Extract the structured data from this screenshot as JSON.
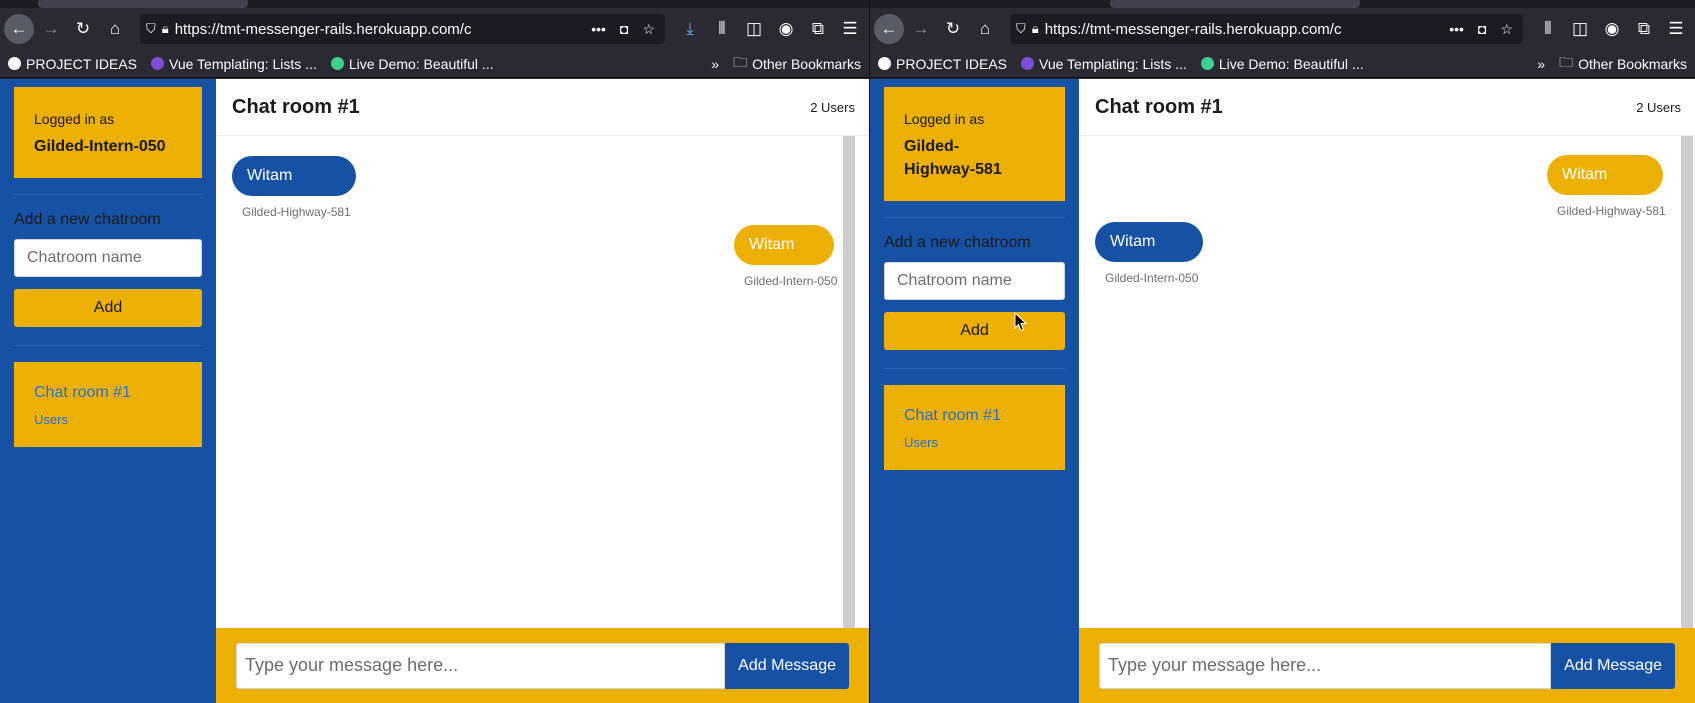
{
  "browser": {
    "url": "https://tmt-messenger-rails.herokuapp.com/c",
    "url_right": "https://tmt-messenger-rails.herokuapp.com/c",
    "bookmarks": [
      {
        "label": "PROJECT IDEAS",
        "icon": "github-icon",
        "color": "#ffffff"
      },
      {
        "label": "Vue Templating: Lists ...",
        "icon": "vue-mastery-icon",
        "color": "#7e4fd6"
      },
      {
        "label": "Live Demo: Beautiful ...",
        "icon": "vue-icon",
        "color": "#3ecf8e"
      }
    ],
    "other_bookmarks": "Other Bookmarks"
  },
  "left": {
    "logged_in_label": "Logged in as",
    "username": "Gilded-Intern-050",
    "add_chatroom_label": "Add a new chatroom",
    "chatroom_placeholder": "Chatroom name",
    "add_button": "Add",
    "rooms": [
      {
        "name": "Chat room #1",
        "users": "Users"
      }
    ],
    "chat_title": "Chat room #1",
    "user_count": "2 Users",
    "messages": [
      {
        "text": "Witam",
        "user": "Gilded-Highway-581",
        "side": "left",
        "color": "blue"
      },
      {
        "text": "Witam",
        "user": "Gilded-Intern-050",
        "side": "right",
        "color": "yellow"
      }
    ],
    "message_placeholder": "Type your message here...",
    "send_button": "Add Message"
  },
  "right": {
    "logged_in_label": "Logged in as",
    "username_line1": "Gilded-",
    "username_line2": "Highway-581",
    "add_chatroom_label": "Add a new chatroom",
    "chatroom_placeholder": "Chatroom name",
    "add_button": "Add",
    "rooms": [
      {
        "name": "Chat room #1",
        "users": "Users"
      }
    ],
    "chat_title": "Chat room #1",
    "user_count": "2 Users",
    "messages": [
      {
        "text": "Witam",
        "user": "Gilded-Highway-581",
        "side": "right",
        "color": "yellow"
      },
      {
        "text": "Witam",
        "user": "Gilded-Intern-050",
        "side": "left",
        "color": "blue"
      }
    ],
    "message_placeholder": "Type your message here...",
    "send_button": "Add Message"
  },
  "colors": {
    "brand_blue": "#1651a3",
    "brand_yellow": "#ecb005"
  }
}
